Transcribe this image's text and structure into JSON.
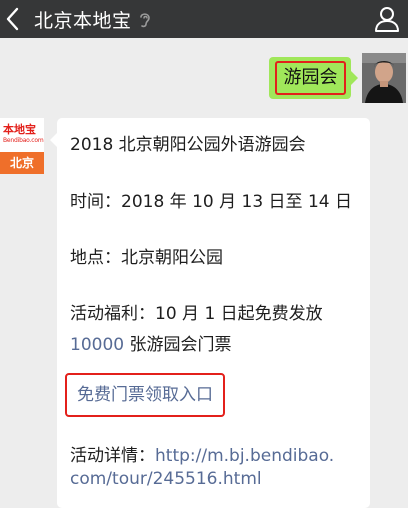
{
  "header": {
    "title": "北京本地宝",
    "back_icon": "chevron-left-icon",
    "ear_icon": "ear-icon",
    "profile_icon": "user-icon"
  },
  "sent_message": {
    "text": "游园会"
  },
  "brand": {
    "logo_text": "本地宝",
    "domain_text": "Bendibao.com",
    "city_text": "北京"
  },
  "reply": {
    "title": "2018 北京朝阳公园外语游园会",
    "time": "时间：2018 年 10 月 13 日至 14 日",
    "location": "地点：北京朝阳公园",
    "benefit_prefix": "活动福利：10 月 1 日起免费发放",
    "benefit_count": "10000",
    "benefit_suffix": " 张游园会门票",
    "free_ticket_link": "免费门票领取入口",
    "details_label": "活动详情：",
    "details_url_part1": "http://m.bj.bendibao.",
    "details_url_part2": "com/tour/245516.html"
  },
  "colors": {
    "topbar": "#363738",
    "background": "#ededed",
    "sent_bubble": "#a0e75a",
    "highlight_border": "#e3201b",
    "link": "#576b95",
    "brand_orange": "#ef6f2a"
  }
}
